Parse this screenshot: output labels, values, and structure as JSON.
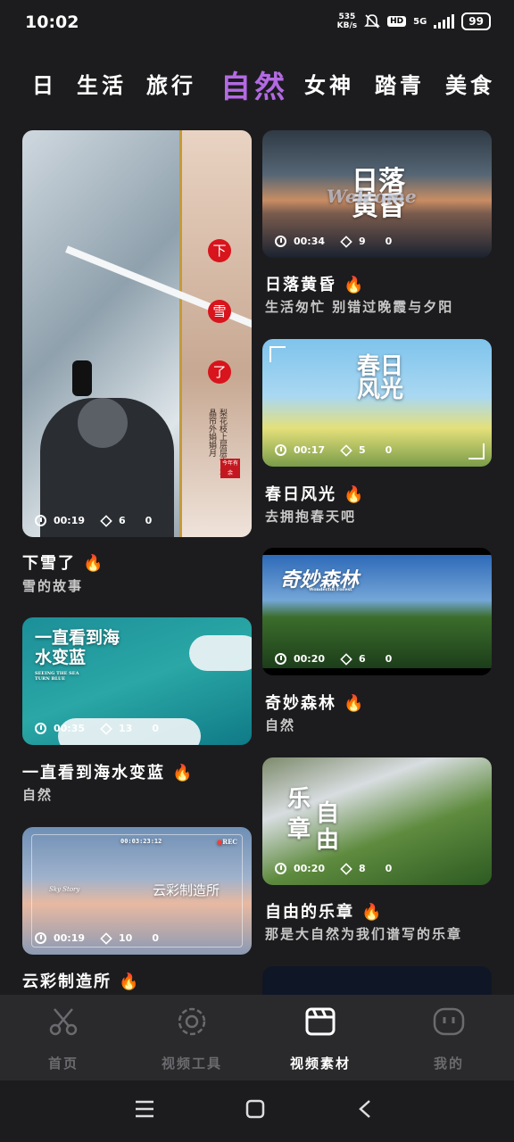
{
  "status": {
    "time": "10:02",
    "netspeed_value": "535",
    "netspeed_unit": "KB/s",
    "hd": "HD",
    "network": "5G",
    "battery": "99"
  },
  "tabs": [
    {
      "label": "日",
      "active": false
    },
    {
      "label": "生活",
      "active": false
    },
    {
      "label": "旅行",
      "active": false
    },
    {
      "label": "自然",
      "active": true
    },
    {
      "label": "女神",
      "active": false
    },
    {
      "label": "踏青",
      "active": false
    },
    {
      "label": "美食",
      "active": false
    }
  ],
  "cards": [
    {
      "id": "snow",
      "duration": "00:19",
      "layers": "6",
      "count": "0",
      "title": "下雪了",
      "subtitle": "雪的故事",
      "overlay": [
        "下",
        "雪",
        "了"
      ],
      "poem": "梨花枝上层层雪 水晶帘外娟娟月",
      "seal": "今年有余"
    },
    {
      "id": "sunset",
      "duration": "00:34",
      "layers": "9",
      "count": "0",
      "title": "日落黄昏",
      "subtitle": "生活匆忙 别错过晚霞与夕阳",
      "overlay": "日落黄昏",
      "overlay2": "Welcome"
    },
    {
      "id": "spring",
      "duration": "00:17",
      "layers": "5",
      "count": "0",
      "title": "春日风光",
      "subtitle": "去拥抱春天吧",
      "overlay": "春日风光"
    },
    {
      "id": "sea",
      "duration": "00:35",
      "layers": "13",
      "count": "0",
      "title": "一直看到海水变蓝",
      "subtitle": "自然",
      "overlay": "一直看到海水变蓝",
      "overlay_small": "SEEING THE SEA TURN BLUE"
    },
    {
      "id": "forest",
      "duration": "00:20",
      "layers": "6",
      "count": "0",
      "title": "奇妙森林",
      "subtitle": "自然",
      "overlay": "奇妙森林",
      "overlay_small": "Wonderful Forest"
    },
    {
      "id": "cloud",
      "duration": "00:19",
      "layers": "10",
      "count": "0",
      "title": "云彩制造所",
      "subtitle": "",
      "overlay": "云彩制造所",
      "overlay_small": "Sky Story",
      "rec": "REC",
      "timecode": "00:03:23:12"
    },
    {
      "id": "freedom",
      "duration": "00:20",
      "layers": "8",
      "count": "0",
      "title": "自由的乐章",
      "subtitle": "那是大自然为我们谱写的乐章",
      "overlay": [
        "乐",
        "自",
        "章",
        "由"
      ]
    }
  ],
  "bottom_nav": [
    {
      "label": "首页",
      "icon": "scissors-icon",
      "active": false
    },
    {
      "label": "视频工具",
      "icon": "gear-icon",
      "active": false
    },
    {
      "label": "视频素材",
      "icon": "clapperboard-icon",
      "active": true
    },
    {
      "label": "我的",
      "icon": "face-icon",
      "active": false
    }
  ],
  "colors": {
    "accent": "#b36ae2",
    "fire": "#ff8a1f",
    "background": "#1c1c1e"
  }
}
